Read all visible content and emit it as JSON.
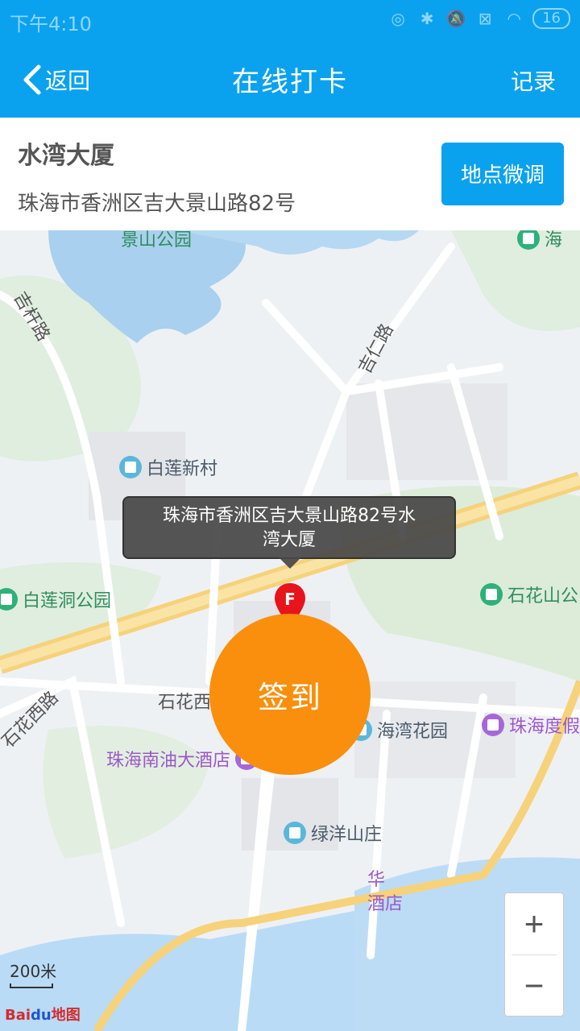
{
  "status_bar": {
    "time": "下午4:10",
    "battery": "16"
  },
  "app_bar": {
    "back_label": "返回",
    "title": "在线打卡",
    "records_label": "记录"
  },
  "address": {
    "name": "水湾大厦",
    "full": "珠海市香洲区吉大景山路82号",
    "adjust_label": "地点微调"
  },
  "map": {
    "callout_line1": "珠海市香洲区吉大景山路82号水",
    "callout_line2": "湾大厦",
    "marker_letter": "F",
    "scale": "200米",
    "logo_a": "Bai",
    "logo_b": "du",
    "logo_c": "地图",
    "zoom_in": "+",
    "zoom_out": "−",
    "pois": {
      "jingshan_park": "景山公园",
      "bailian_xincun": "白莲新村",
      "bailiandong_park": "白莲洞公园",
      "shihuashan": "石花山公",
      "haiwan_garden": "海湾花园",
      "nanyou_hotel": "珠海南油大酒店",
      "luyang": "绿洋山庄",
      "zhuhai_resort": "珠海度假",
      "hua": "华",
      "hotel_tail": "酒店",
      "hai": "海"
    },
    "roads": {
      "jiren": "吉仁路",
      "shihua_west": "石花西路",
      "shihua_west_2": "石花西路",
      "jiguang": "吉杆路"
    }
  },
  "checkin_label": "签到"
}
